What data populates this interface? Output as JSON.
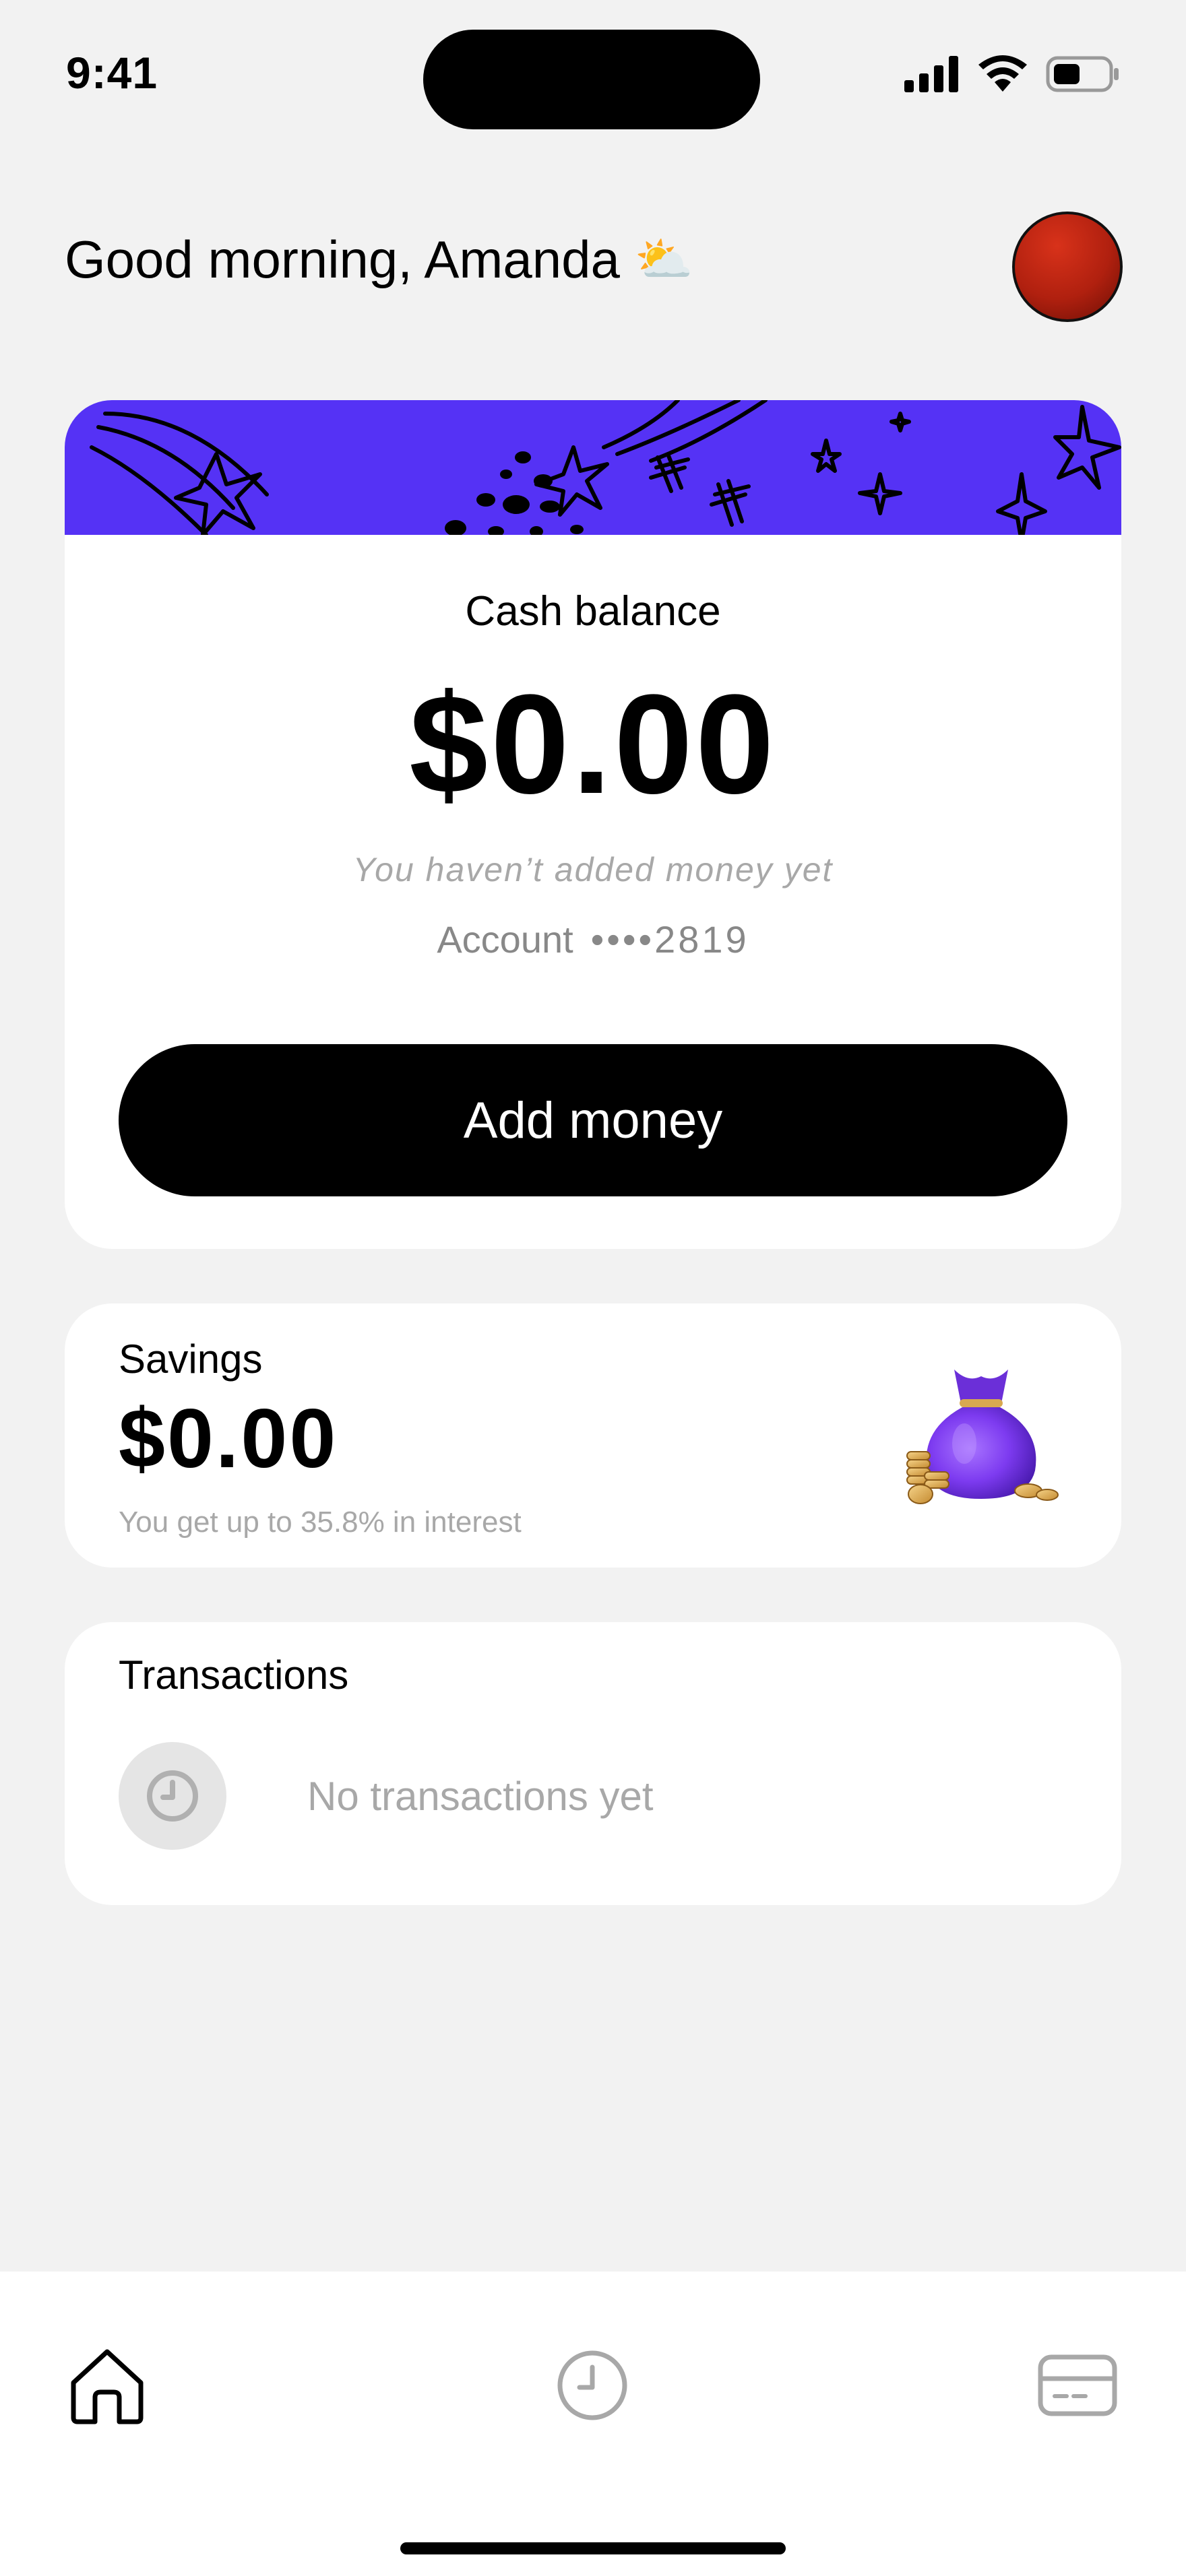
{
  "status_bar": {
    "time": "9:41",
    "icons": [
      "cellular-signal-icon",
      "wifi-icon",
      "battery-icon"
    ]
  },
  "header": {
    "greeting": "Good morning, Amanda",
    "weather_emoji": "⛅"
  },
  "balance": {
    "label": "Cash balance",
    "amount": "$0.00",
    "note": "You haven’t added money yet",
    "account_label": "Account",
    "account_mask": "••••2819",
    "add_money_label": "Add money"
  },
  "savings": {
    "label": "Savings",
    "amount": "$0.00",
    "note": "You get up to 35.8% in interest"
  },
  "transactions": {
    "label": "Transactions",
    "empty_text": "No transactions yet"
  },
  "tab_bar": {
    "tabs": [
      {
        "icon": "home-icon",
        "active": true
      },
      {
        "icon": "clock-icon",
        "active": false
      },
      {
        "icon": "card-icon",
        "active": false
      }
    ]
  },
  "colors": {
    "accent": "#5532f5",
    "background": "#f2f2f2",
    "button": "#000000",
    "muted_text": "#a8a8a8"
  }
}
